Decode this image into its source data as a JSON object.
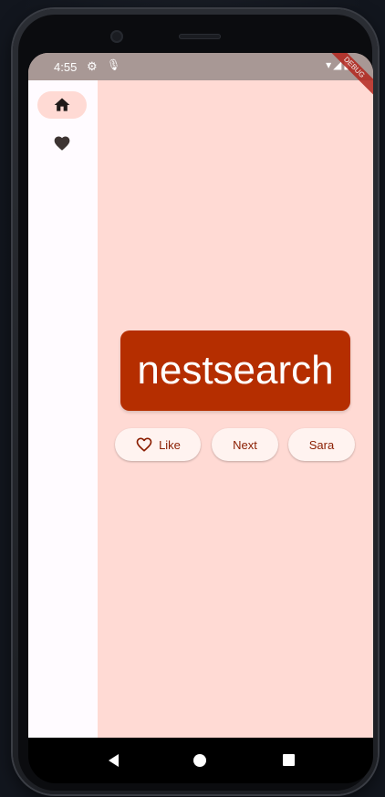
{
  "status_bar": {
    "time": "4:55",
    "icons": [
      "gear-icon",
      "mic-icon",
      "wifi-icon",
      "signal-icon",
      "battery-icon"
    ],
    "debug_banner": "DEBUG"
  },
  "nav_rail": {
    "items": [
      {
        "icon": "home-icon",
        "selected": true
      },
      {
        "icon": "heart-icon",
        "selected": false
      }
    ]
  },
  "main": {
    "word": "nestsearch",
    "buttons": {
      "like_label": "Like",
      "next_label": "Next",
      "name_label": "Sara"
    }
  },
  "system_nav": {
    "icons": [
      "back-icon",
      "home-circle-icon",
      "recents-icon"
    ]
  },
  "colors": {
    "background": "#ffdad4",
    "rail": "#fffbff",
    "card": "#b52e00",
    "card_text": "#ffffff",
    "button_bg": "#fff3f0",
    "button_text": "#8a1d00",
    "status_bar": "#a89895"
  }
}
